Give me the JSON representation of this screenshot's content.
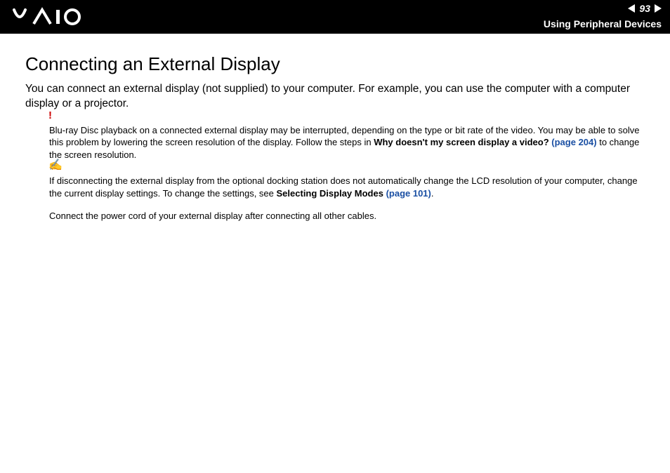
{
  "header": {
    "page_number": "93",
    "section": "Using Peripheral Devices"
  },
  "title": "Connecting an External Display",
  "intro": "You can connect an external display (not supplied) to your computer. For example, you can use the computer with a computer display or a projector.",
  "warn": {
    "icon_name": "warning-icon",
    "pre": "Blu-ray Disc playback on a connected external display may be interrupted, depending on the type or bit rate of the video. You may be able to solve this problem by lowering the screen resolution of the display. Follow the steps in ",
    "bold": "Why doesn't my screen display a video?",
    "link": " (page 204)",
    "post": " to change the screen resolution."
  },
  "tip": {
    "icon_name": "tip-icon",
    "pre": "If disconnecting the external display from the optional docking station does not automatically change the LCD resolution of your computer, change the current display settings. To change the settings, see ",
    "bold": "Selecting Display Modes",
    "link": " (page 101)",
    "post": "."
  },
  "plain": "Connect the power cord of your external display after connecting all other cables."
}
